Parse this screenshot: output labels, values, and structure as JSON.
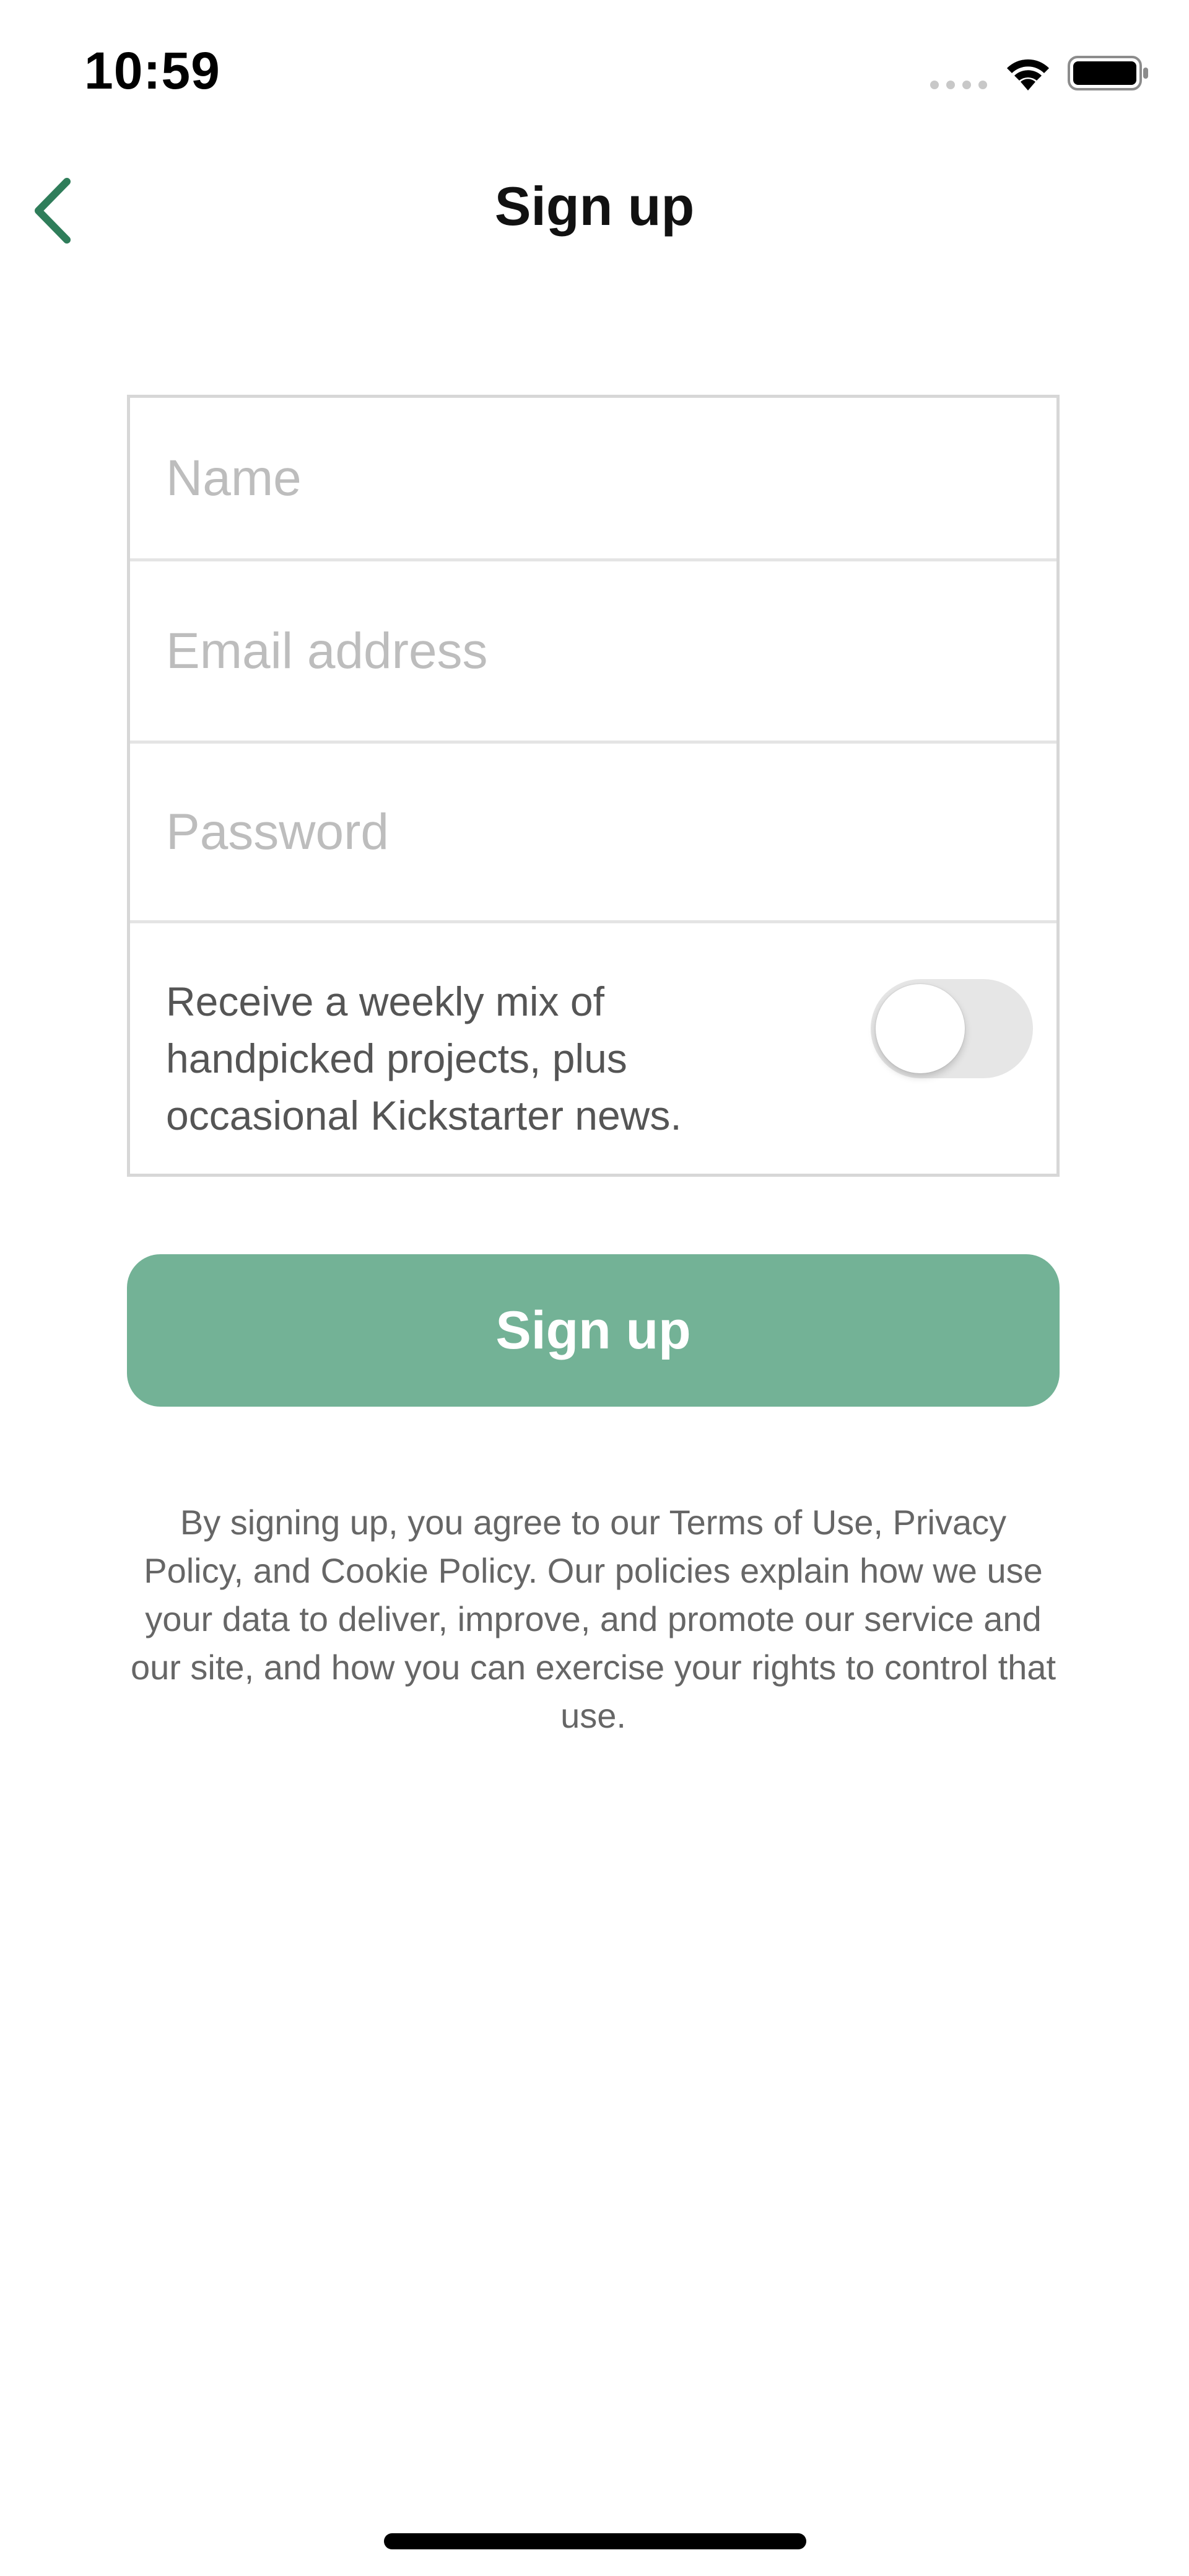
{
  "status_bar": {
    "time": "10:59"
  },
  "icons": {
    "back": "chevron-left-icon",
    "signal": "cellular-signal-icon",
    "wifi": "wifi-icon",
    "battery": "battery-icon"
  },
  "nav": {
    "title": "Sign up"
  },
  "form": {
    "name_placeholder": "Name",
    "name_value": "",
    "email_placeholder": "Email address",
    "email_value": "",
    "password_placeholder": "Password",
    "password_value": "",
    "newsletter_text": "Receive a weekly mix of handpicked projects, plus occasional Kickstarter news.",
    "newsletter_enabled": false
  },
  "signup_button": {
    "label": "Sign up"
  },
  "legal": {
    "text": "By signing up, you agree to our Terms of Use, Privacy Policy, and Cookie Policy. Our policies explain how we use your data to deliver, improve, and promote our service and our site, and how you can exercise your rights to control that use."
  },
  "colors": {
    "accent": "#2f7d5a",
    "button": "#73b296",
    "toggle_off": "#e6e6e6"
  }
}
